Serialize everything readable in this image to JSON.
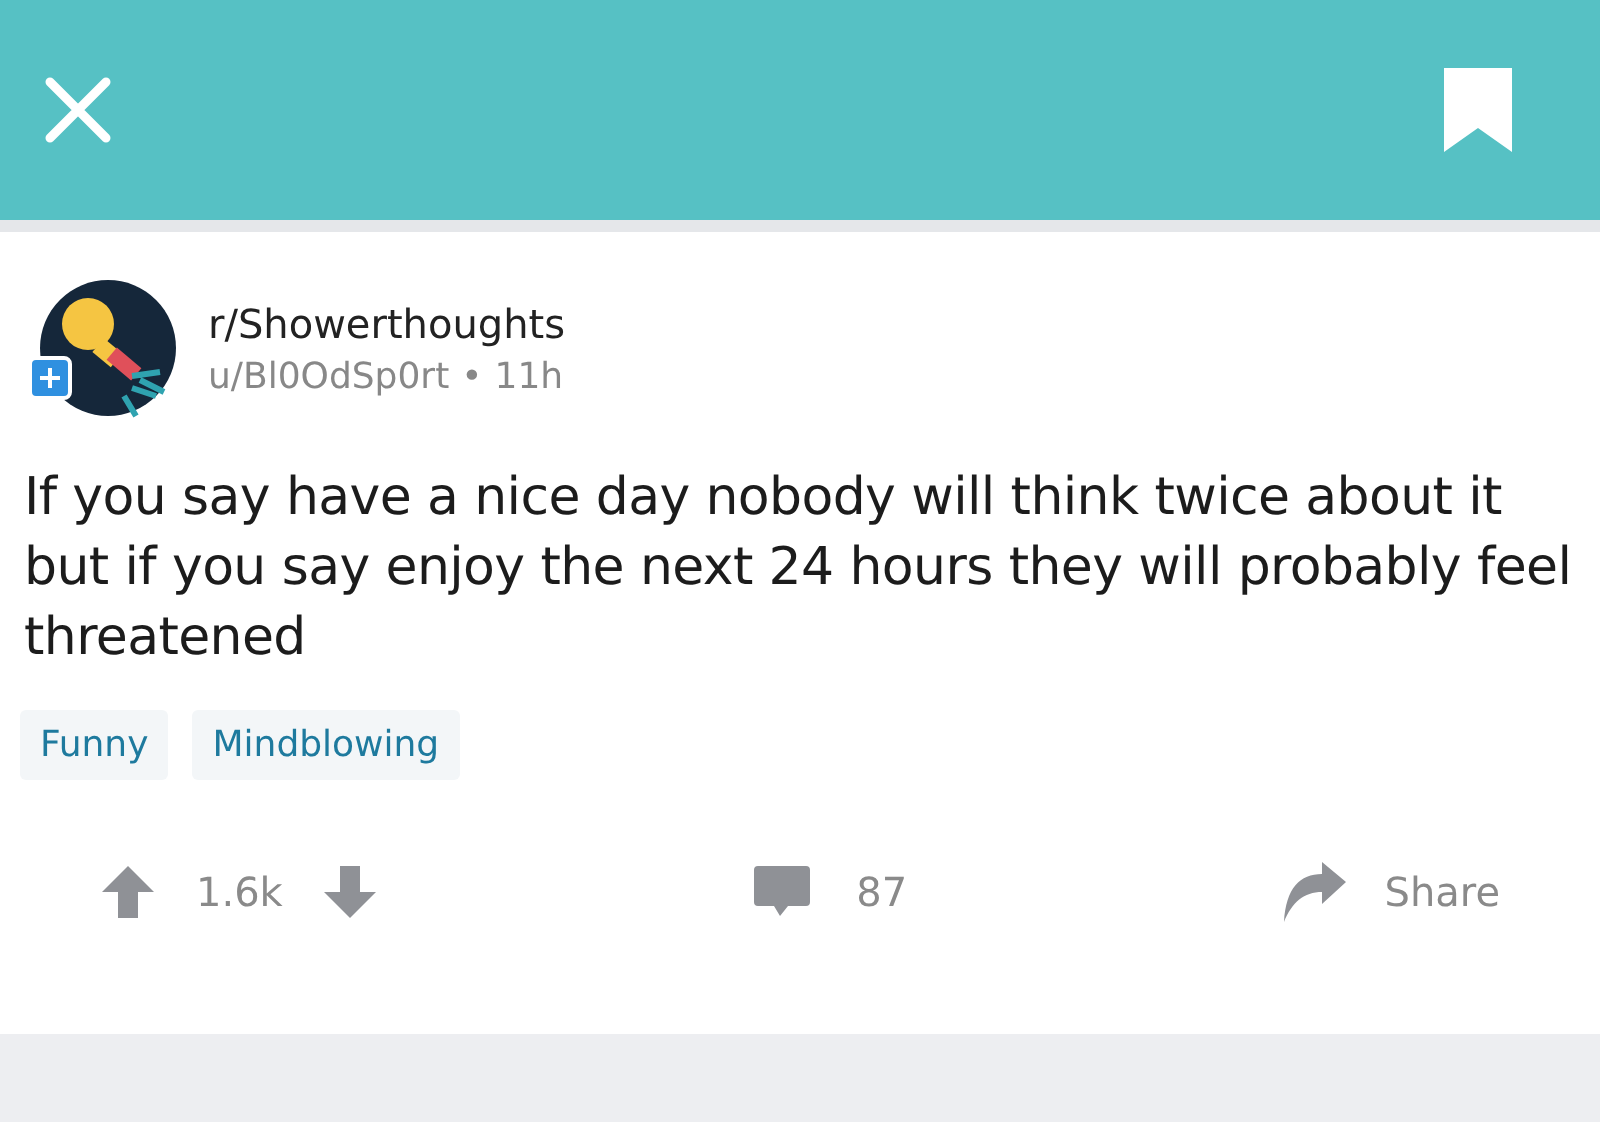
{
  "post": {
    "subreddit": "r/Showerthoughts",
    "author": "u/Bl0OdSp0rt",
    "separator": "•",
    "age": "11h",
    "title": "If you say have a nice day nobody will think twice about it but if you say enjoy the next 24 hours they will probably feel threatened",
    "flairs": [
      "Funny",
      "Mindblowing"
    ],
    "score": "1.6k",
    "comments": "87",
    "share": "Share"
  }
}
